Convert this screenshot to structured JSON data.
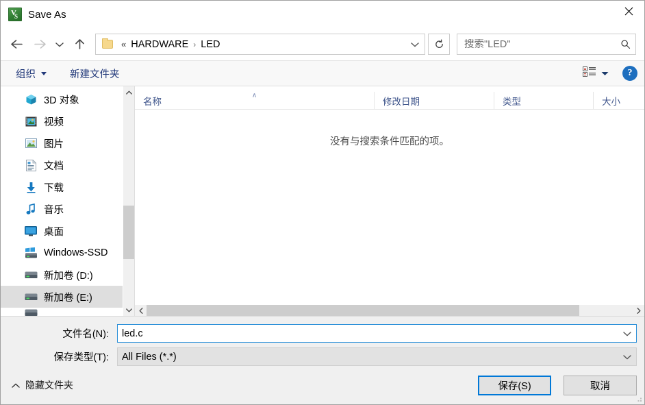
{
  "window": {
    "title": "Save As",
    "icon": "app-icon-green-vs",
    "icon_glyph_top": "V",
    "icon_glyph_bottom": "S",
    "close_label": "✕"
  },
  "nav": {
    "back": "←",
    "forward": "→",
    "recent": "∨",
    "up": "↑",
    "refresh": "↻"
  },
  "address": {
    "folder_icon": "folder-icon",
    "overflow": "«",
    "crumbs": [
      "HARDWARE",
      "LED"
    ],
    "separator": "›",
    "dropdown": "∨"
  },
  "search": {
    "placeholder": "搜索\"LED\"",
    "value": "",
    "icon": "search-icon"
  },
  "commandbar": {
    "organize": "组织",
    "new_folder": "新建文件夹",
    "view_icon": "view-mode-icon",
    "view_caret": "▼",
    "help": "?"
  },
  "sidebar": {
    "items": [
      {
        "label": "3D 对象",
        "icon": "3d-objects-icon",
        "selected": false
      },
      {
        "label": "视频",
        "icon": "videos-icon",
        "selected": false
      },
      {
        "label": "图片",
        "icon": "pictures-icon",
        "selected": false
      },
      {
        "label": "文档",
        "icon": "documents-icon",
        "selected": false
      },
      {
        "label": "下载",
        "icon": "downloads-icon",
        "selected": false
      },
      {
        "label": "音乐",
        "icon": "music-icon",
        "selected": false
      },
      {
        "label": "桌面",
        "icon": "desktop-icon",
        "selected": false
      },
      {
        "label": "Windows-SSD",
        "icon": "windows-drive-icon",
        "selected": false
      },
      {
        "label": "新加卷 (D:)",
        "icon": "drive-icon",
        "selected": false
      },
      {
        "label": "新加卷 (E:)",
        "icon": "drive-icon",
        "selected": true
      }
    ],
    "scroll_up": "∧",
    "scroll_down": "∨"
  },
  "filelist": {
    "columns": [
      {
        "label": "名称",
        "sorted": "asc",
        "sort_glyph": "∧"
      },
      {
        "label": "修改日期",
        "sorted": "",
        "sort_glyph": ""
      },
      {
        "label": "类型",
        "sorted": "",
        "sort_glyph": ""
      },
      {
        "label": "大小",
        "sorted": "",
        "sort_glyph": ""
      }
    ],
    "rows": [],
    "empty_message": "没有与搜索条件匹配的项。",
    "scroll_left": "‹",
    "scroll_right": "›"
  },
  "footer": {
    "filename_label": "文件名(N):",
    "filename_value": "led.c",
    "filename_caret": "∨",
    "filetype_label": "保存类型(T):",
    "filetype_value": "All Files (*.*)",
    "filetype_caret": "∨",
    "hide_folders_caret": "∧",
    "hide_folders_label": "隐藏文件夹",
    "save_label": "保存(S)",
    "cancel_label": "取消"
  },
  "colors": {
    "accent": "#0078d7",
    "focus_border": "#2a8fd8",
    "command_text": "#22397a",
    "column_text": "#40568c",
    "help_blue": "#1e6fbf",
    "selection": "#dedede"
  }
}
